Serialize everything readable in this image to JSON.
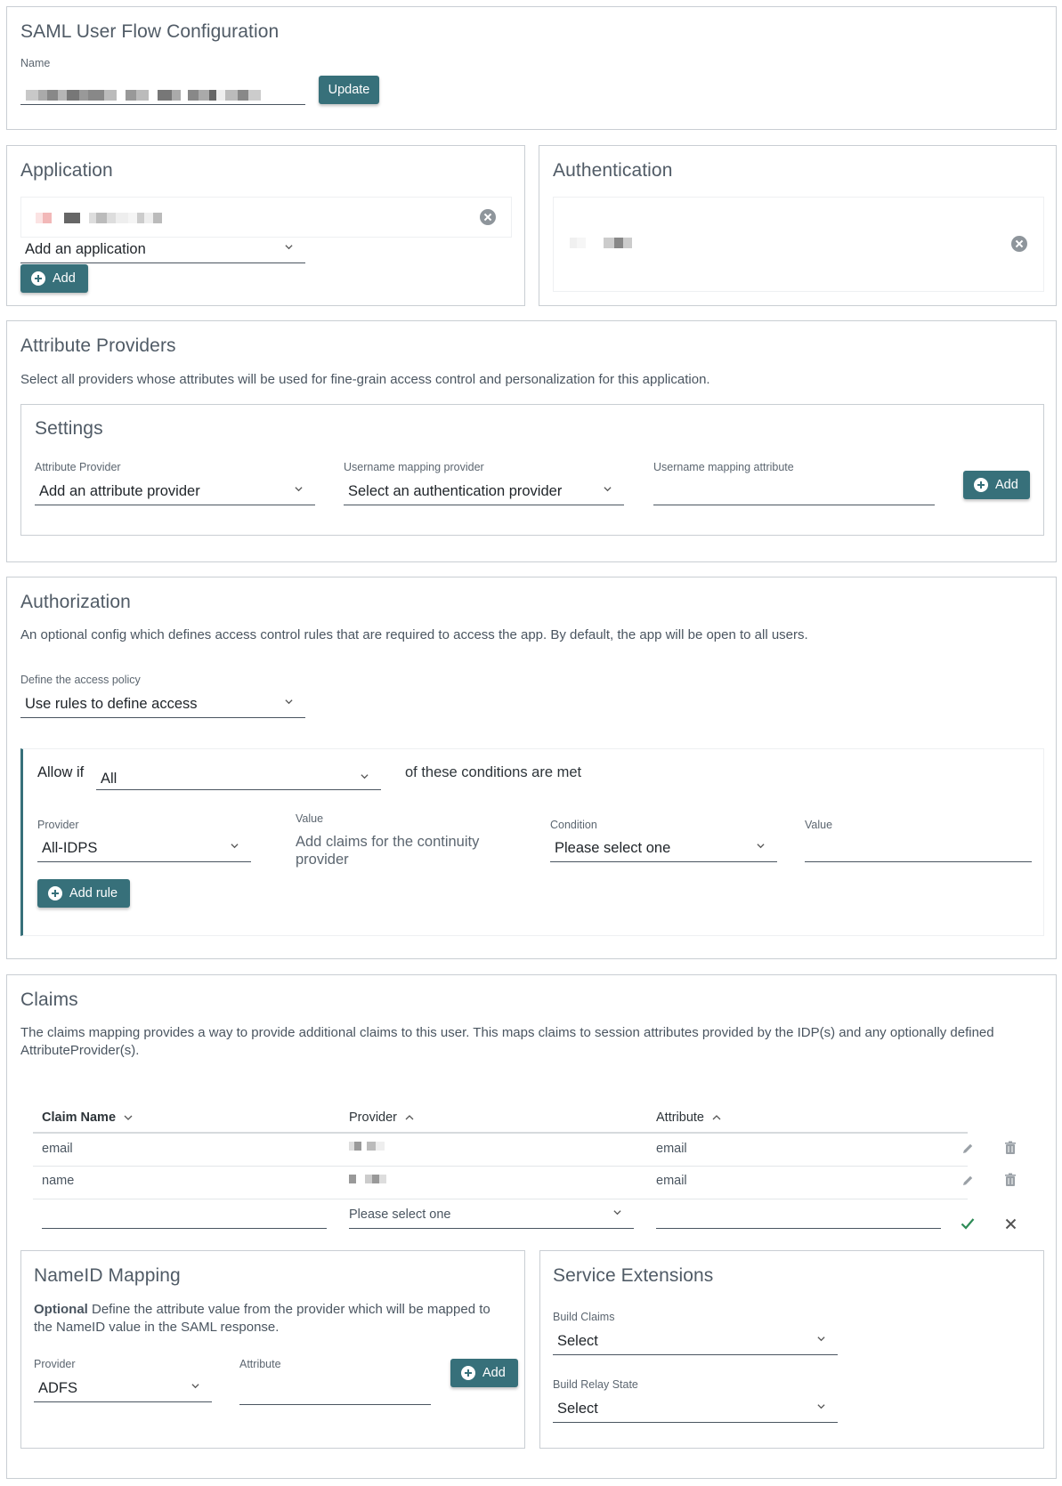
{
  "header": {
    "title": "SAML User Flow Configuration",
    "name_label": "Name",
    "update_label": "Update"
  },
  "application": {
    "title": "Application",
    "select_value": "Add an application",
    "add_label": "Add"
  },
  "authentication": {
    "title": "Authentication"
  },
  "attribute_providers": {
    "title": "Attribute Providers",
    "description": "Select all providers whose attributes will be used for fine-grain access control and personalization for this application.",
    "settings_title": "Settings",
    "provider_label": "Attribute Provider",
    "provider_value": "Add an attribute provider",
    "username_provider_label": "Username mapping provider",
    "username_provider_value": "Select an authentication provider",
    "username_attribute_label": "Username mapping attribute",
    "add_label": "Add"
  },
  "authorization": {
    "title": "Authorization",
    "description": "An optional config which defines access control rules that are required to access the app. By default, the app will be open to all users.",
    "policy_label": "Define the access policy",
    "policy_value": "Use rules to define access",
    "allow_if": "Allow if",
    "match_value": "All",
    "conditions_text": "of these conditions are met",
    "provider_label": "Provider",
    "provider_value": "All-IDPS",
    "value_label": "Value",
    "value_text": "Add claims for the continuity provider",
    "condition_label": "Condition",
    "condition_value": "Please select one",
    "value2_label": "Value",
    "add_rule_label": "Add rule"
  },
  "claims": {
    "title": "Claims",
    "description": "The claims mapping provides a way to provide additional claims to this user. This maps claims to session attributes provided by the IDP(s) and any optionally defined AttributeProvider(s).",
    "columns": [
      "Claim Name",
      "Provider",
      "Attribute"
    ],
    "rows": [
      {
        "claim": "email",
        "attribute": "email"
      },
      {
        "claim": "name",
        "attribute": "email"
      }
    ],
    "new_provider_placeholder": "Please select one"
  },
  "nameid": {
    "title": "NameID Mapping",
    "optional": "Optional",
    "description": " Define the attribute value from the provider which will be mapped to the NameID value in the SAML response.",
    "provider_label": "Provider",
    "provider_value": "ADFS",
    "attribute_label": "Attribute",
    "add_label": "Add"
  },
  "service_extensions": {
    "title": "Service Extensions",
    "build_claims_label": "Build Claims",
    "build_claims_value": "Select",
    "build_relay_label": "Build Relay State",
    "build_relay_value": "Select"
  },
  "colors": {
    "accent": "#37707a",
    "border": "#c9ced3",
    "text": "#4a5560",
    "check": "#2e8b57"
  }
}
